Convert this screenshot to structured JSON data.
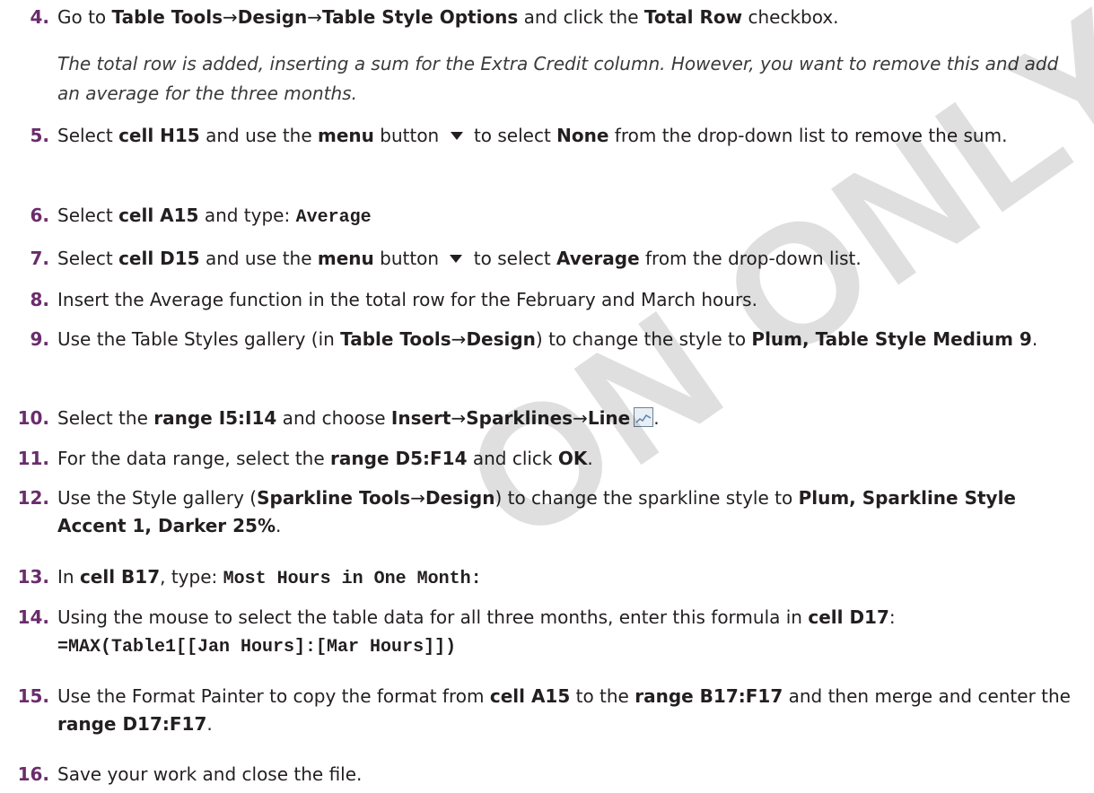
{
  "steps": [
    {
      "num": "4.",
      "parts": [
        "Go to ",
        "Table Tools",
        "→",
        "Design",
        "→",
        "Table Style Options",
        " and click the ",
        "Total Row",
        " checkbox."
      ]
    },
    {
      "note": "The total row is added, inserting a sum for the Extra Credit column. However, you want to remove this and add an average for the three months."
    },
    {
      "num": "5.",
      "parts": [
        "Select ",
        "cell H15",
        " and use the ",
        "menu",
        " button ",
        " to select ",
        "None",
        " from the drop-down list to remove the sum."
      ]
    },
    {
      "num": "6.",
      "parts": [
        "Select ",
        "cell A15",
        " and type: ",
        "Average"
      ]
    },
    {
      "num": "7.",
      "parts": [
        "Select ",
        "cell D15",
        " and use the ",
        "menu",
        " button ",
        " to select ",
        "Average",
        " from the drop-down list."
      ]
    },
    {
      "num": "8.",
      "parts": [
        "Insert the Average function in the total row for the February and March hours."
      ]
    },
    {
      "num": "9.",
      "parts": [
        "Use the Table Styles gallery (in ",
        "Table Tools",
        "→",
        "Design",
        ") to change the style to ",
        "Plum, Table Style Medium 9",
        "."
      ]
    },
    {
      "num": "10.",
      "parts": [
        "Select the ",
        "range I5:I14",
        " and choose ",
        "Insert",
        "→",
        "Sparklines",
        "→",
        "Line",
        "."
      ]
    },
    {
      "num": "11.",
      "parts": [
        "For the data range, select the ",
        "range D5:F14",
        " and click ",
        "OK",
        "."
      ]
    },
    {
      "num": "12.",
      "parts": [
        "Use the Style gallery (",
        "Sparkline Tools",
        "→",
        "Design",
        ") to change the sparkline style to ",
        "Plum, Sparkline Style Accent 1, Darker 25%",
        "."
      ]
    },
    {
      "num": "13.",
      "parts": [
        "In ",
        "cell B17",
        ", type: ",
        "Most Hours in One Month:"
      ]
    },
    {
      "num": "14.",
      "parts": [
        "Using the mouse to select the table data for all three months, enter this formula in ",
        "cell D17",
        ":",
        "=MAX(Table1[[Jan Hours]:[Mar Hours]])"
      ]
    },
    {
      "num": "15.",
      "parts": [
        "Use the Format Painter to copy the format from ",
        "cell A15",
        " to the ",
        "range B17:F17",
        " and then merge and center the ",
        "range D17:F17",
        "."
      ]
    },
    {
      "num": "16.",
      "parts": [
        "Save your work and close the file."
      ]
    }
  ],
  "watermark": "ON ONLY"
}
